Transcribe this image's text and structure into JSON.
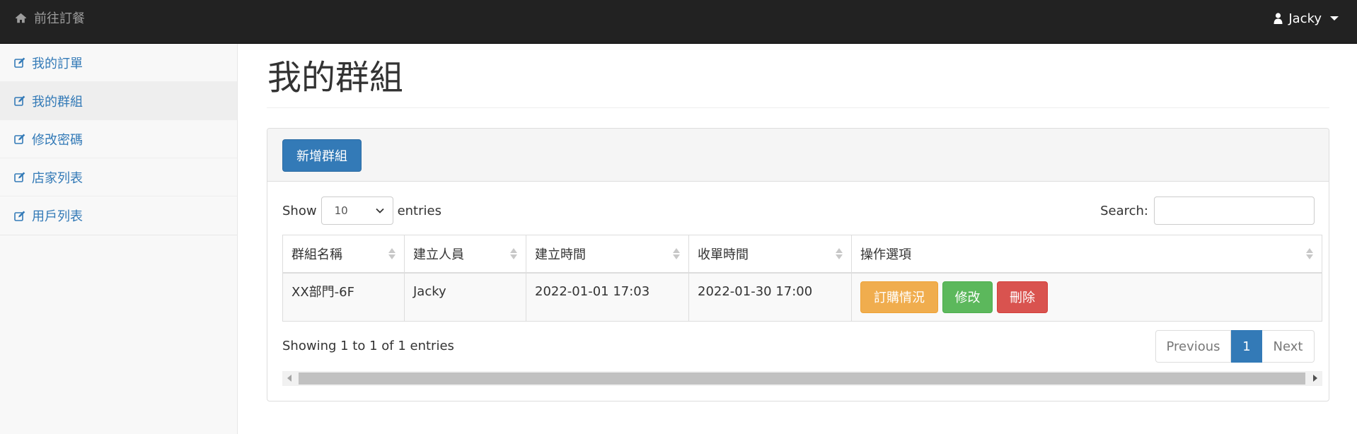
{
  "navbar": {
    "brand": "前往訂餐",
    "brand_icon": "home-icon",
    "user": "Jacky",
    "user_icon": "user-icon"
  },
  "sidebar": {
    "items": [
      {
        "label": "我的訂單",
        "icon": "edit-icon",
        "active": false
      },
      {
        "label": "我的群組",
        "icon": "edit-icon",
        "active": true
      },
      {
        "label": "修改密碼",
        "icon": "edit-icon",
        "active": false
      },
      {
        "label": "店家列表",
        "icon": "edit-icon",
        "active": false
      },
      {
        "label": "用戶列表",
        "icon": "edit-icon",
        "active": false
      }
    ]
  },
  "main": {
    "title": "我的群組",
    "add_button": "新增群組",
    "show_label": "Show",
    "entries_value": "10",
    "entries_label": "entries",
    "search_label": "Search:",
    "search_value": "",
    "table": {
      "headers": [
        "群組名稱",
        "建立人員",
        "建立時間",
        "收單時間",
        "操作選項"
      ],
      "rows": [
        {
          "name": "XX部門-6F",
          "creator": "Jacky",
          "created": "2022-01-01 17:03",
          "closing": "2022-01-30 17:00",
          "actions": {
            "order": "訂購情況",
            "edit": "修改",
            "delete": "刪除"
          }
        }
      ]
    },
    "info": "Showing 1 to 1 of 1 entries",
    "pagination": {
      "previous": "Previous",
      "current": "1",
      "next": "Next"
    }
  },
  "colors": {
    "navbar_bg": "#222222",
    "primary": "#337ab7",
    "warning": "#f0ad4e",
    "success": "#5cb85c",
    "danger": "#d9534f"
  }
}
